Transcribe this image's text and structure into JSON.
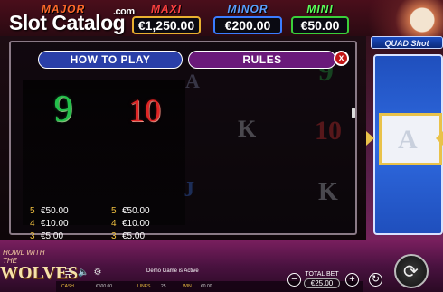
{
  "watermark": {
    "text": "Slot Catalog",
    "suffix": ".com"
  },
  "jackpots": {
    "major": {
      "title": "MAJOR",
      "value": ""
    },
    "maxi": {
      "title": "MAXI",
      "value": "€1,250.00"
    },
    "minor": {
      "title": "MINOR",
      "value": "€200.00"
    },
    "mini": {
      "title": "MINI",
      "value": "€50.00"
    }
  },
  "quad_shot": {
    "logo": "QUAD Shot"
  },
  "background_symbols": {
    "k1": "K",
    "k2": "K",
    "ten": "10",
    "nine": "9",
    "j": "J",
    "a": "A"
  },
  "paytable": {
    "tab_how_to_play": "HOW TO PLAY",
    "tab_rules": "RULES",
    "close_label": "x",
    "cards": [
      {
        "symbol": "9",
        "pays": [
          {
            "count": "5",
            "amount": "€50.00"
          },
          {
            "count": "4",
            "amount": "€10.00"
          },
          {
            "count": "3",
            "amount": "€5.00"
          }
        ]
      },
      {
        "symbol": "10",
        "pays": [
          {
            "count": "5",
            "amount": "€50.00"
          },
          {
            "count": "4",
            "amount": "€10.00"
          },
          {
            "count": "3",
            "amount": "€5.00"
          }
        ]
      }
    ]
  },
  "game_logo": {
    "line1": "HOWL WITH THE",
    "line2": "WOLVES"
  },
  "status": {
    "demo_text": "Demo Game is Active"
  },
  "info": {
    "cash_label": "CASH",
    "cash_value": "€500.00",
    "lines_label": "LINES",
    "lines_value": "25",
    "win_label": "WIN",
    "win_value": "€0.00"
  },
  "total_bet": {
    "label": "TOTAL BET",
    "value": "€25.00"
  },
  "icons": {
    "menu": "menu-icon",
    "sound": "speaker-icon",
    "settings": "gear-icon",
    "minus": "minus-icon",
    "plus": "plus-icon",
    "autoplay": "autoplay-icon",
    "spin": "spin-icon"
  }
}
